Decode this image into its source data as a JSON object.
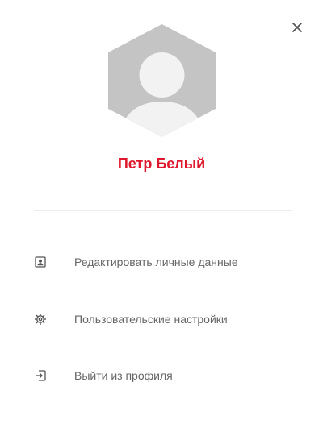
{
  "user": {
    "name": "Петр Белый",
    "avatar_icon": "user-avatar-placeholder-icon"
  },
  "header": {
    "close_icon": "close-icon"
  },
  "menu": {
    "items": [
      {
        "label": "Редактировать личные данные",
        "icon": "id-card-icon"
      },
      {
        "label": "Пользовательские настройки",
        "icon": "gear-icon"
      },
      {
        "label": "Выйти из профиля",
        "icon": "logout-icon"
      }
    ]
  },
  "colors": {
    "accent": "#e0182d",
    "avatar_bg": "#c4c4c4",
    "avatar_fg": "#f2f2f2",
    "menu_text": "#666666",
    "icon": "#555555",
    "divider": "#ececec"
  }
}
